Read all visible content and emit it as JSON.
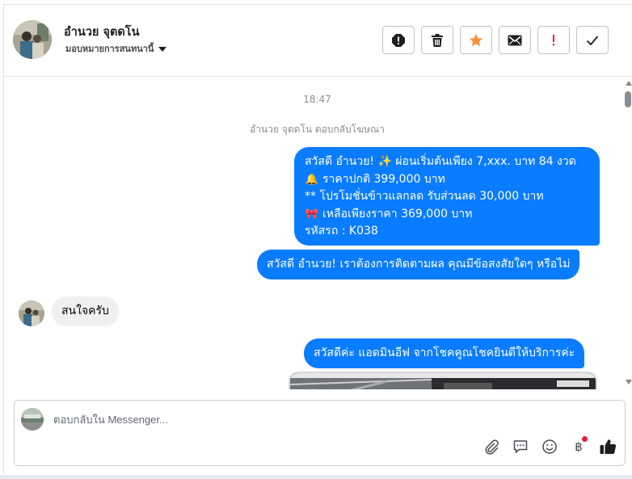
{
  "header": {
    "contact_name": "อำนวย จุตดโน",
    "assign_label": "มอบหมายการสนทนานี้",
    "actions": [
      {
        "name": "spam-button",
        "icon": "exclamation-circle-icon"
      },
      {
        "name": "delete-button",
        "icon": "trash-icon"
      },
      {
        "name": "star-button",
        "icon": "star-icon",
        "color": "#f7923b"
      },
      {
        "name": "mark-unread-button",
        "icon": "envelope-icon"
      },
      {
        "name": "important-button",
        "icon": "exclamation-icon",
        "color": "#e41e3f"
      },
      {
        "name": "mark-done-button",
        "icon": "checkmark-icon"
      }
    ]
  },
  "thread": {
    "timestamp": "18:47",
    "system_note": "อำนวย จุตดโน ตอบกลับโฆษณา",
    "messages": {
      "outgoing_1": {
        "lines": [
          {
            "emoji": "",
            "text": "สวัสดี อำนวย! ✨  ผ่อนเริ่มต้นเพียง 7,xxx. บาท 84 งวด"
          },
          {
            "emoji": "🔔",
            "text": "ราคาปกติ 399,000 บาท"
          },
          {
            "emoji": "",
            "text": "** โปรโมชั่นข้าวแลกลด รับส่วนลด 30,000 บาท"
          },
          {
            "emoji": "🎀",
            "text": " เหลือเพียงราคา 369,000 บาท"
          },
          {
            "emoji": "",
            "text": " รหัสรถ : K038"
          }
        ]
      },
      "outgoing_2": "สวัสดี อำนวย! เราต้องการติดตามผล คุณมีข้อสงสัยใดๆ หรือไม่",
      "incoming_1": "สนใจครับ",
      "outgoing_3": "สวัสดีค่ะ แอดมินอีฟ จากโชคคูณโชคยินดีให้บริการค่ะ"
    }
  },
  "composer": {
    "placeholder": "ตอบกลับใน Messenger...",
    "value": "",
    "tools": [
      "paperclip-icon",
      "saved-reply-icon",
      "emoji-icon",
      "payment-baht-icon",
      "like-icon"
    ],
    "baht_symbol": "฿"
  },
  "colors": {
    "outgoing_bubble": "#0a7cff",
    "incoming_bubble": "#f0f0f0",
    "notification_dot": "#e41e3f"
  }
}
